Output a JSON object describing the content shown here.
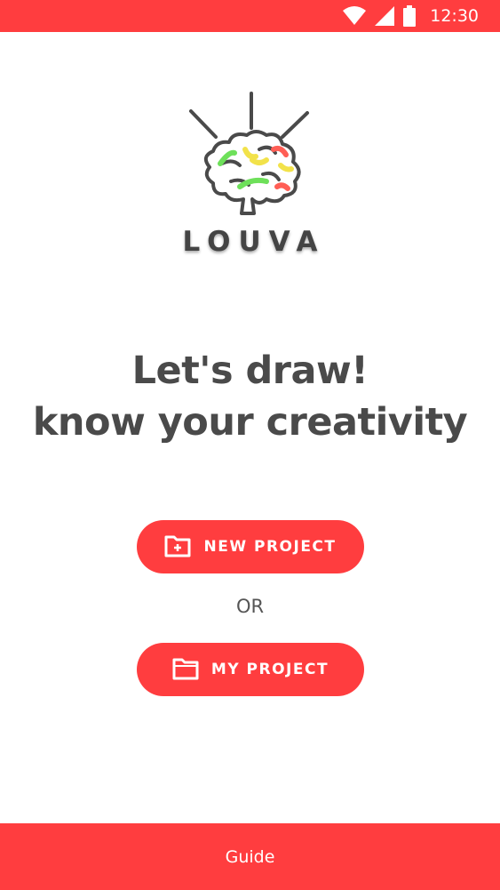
{
  "status_bar": {
    "time": "12:30",
    "icons": [
      "wifi-icon",
      "signal-icon",
      "battery-icon"
    ]
  },
  "logo": {
    "brand": "LOUVA",
    "icon": "brain-lightbulb-icon"
  },
  "headline": {
    "line1": "Let's draw!",
    "line2": "know your creativity"
  },
  "actions": {
    "new_project": {
      "label": "NEW PROJECT",
      "icon": "folder-plus-icon"
    },
    "separator": "OR",
    "my_project": {
      "label": "MY PROJECT",
      "icon": "folder-icon"
    }
  },
  "footer": {
    "guide_label": "Guide"
  },
  "colors": {
    "accent": "#ff3d3f",
    "text": "#444444",
    "brain_green": "#6ee05a",
    "brain_yellow": "#f2e24a",
    "brain_red": "#ff5e55"
  }
}
